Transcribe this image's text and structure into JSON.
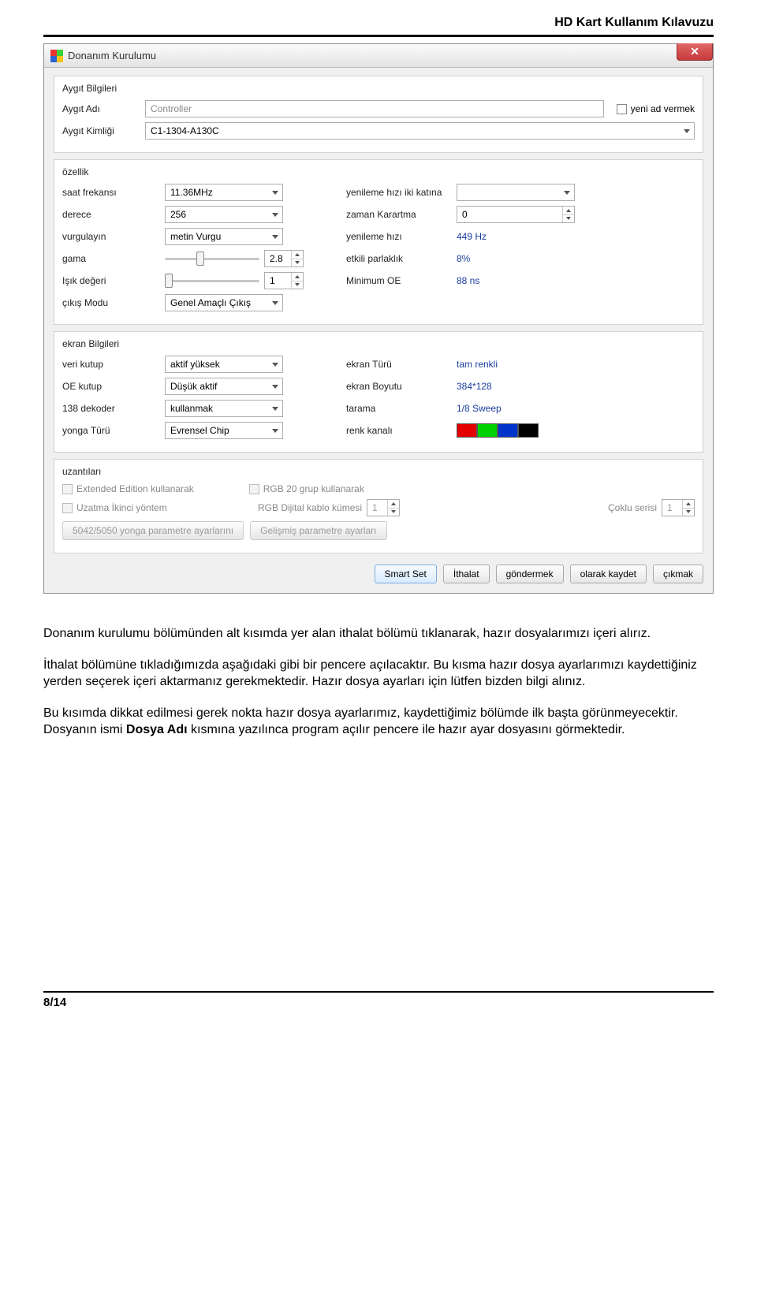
{
  "doc": {
    "header": "HD Kart Kullanım Kılavuzu",
    "page": "8/14"
  },
  "win": {
    "title": "Donanım Kurulumu"
  },
  "dev": {
    "section": "Aygıt Bilgileri",
    "name_lbl": "Aygıt Adı",
    "name_val": "Controller",
    "rename_lbl": "yeni ad vermek",
    "id_lbl": "Aygıt Kimliği",
    "id_val": "C1-1304-A130C"
  },
  "prop": {
    "section": "özellik",
    "clock_lbl": "saat frekansı",
    "clock_val": "11.36MHz",
    "refresh2_lbl": "yenileme hızı iki katına",
    "refresh2_val": "",
    "grade_lbl": "derece",
    "grade_val": "256",
    "blank_lbl": "zaman Karartma",
    "blank_val": "0",
    "emph_lbl": "vurgulayın",
    "emph_val": "metin Vurgu",
    "refresh_lbl": "yenileme hızı",
    "refresh_val": "449 Hz",
    "gamma_lbl": "gama",
    "gamma_val": "2.8",
    "eff_lbl": "etkili parlaklık",
    "eff_val": "8%",
    "light_lbl": "Işık değeri",
    "light_val": "1",
    "minoe_lbl": "Minimum OE",
    "minoe_val": "88 ns",
    "out_lbl": "çıkış Modu",
    "out_val": "Genel Amaçlı Çıkış"
  },
  "scr": {
    "section": "ekran Bilgileri",
    "dpol_lbl": "veri kutup",
    "dpol_val": "aktif yüksek",
    "type_lbl": "ekran Türü",
    "type_val": "tam renkli",
    "oepol_lbl": "OE kutup",
    "oepol_val": "Düşük aktif",
    "size_lbl": "ekran Boyutu",
    "size_val": "384*128",
    "dec_lbl": "138 dekoder",
    "dec_val": "kullanmak",
    "scan_lbl": "tarama",
    "scan_val": "1/8 Sweep",
    "chip_lbl": "yonga Türü",
    "chip_val": "Evrensel Chip",
    "chan_lbl": "renk kanalı",
    "colors": [
      "#e40000",
      "#00d200",
      "#0033cc",
      "#000000"
    ]
  },
  "ext": {
    "section": "uzantıları",
    "ee_lbl": "Extended Edition kullanarak",
    "rgb20_lbl": "RGB 20 grup kullanarak",
    "delay_lbl": "Uzatma İkinci yöntem",
    "cable_lbl": "RGB Dijital kablo kümesi",
    "cable_val": "1",
    "multi_lbl": "Çoklu serisi",
    "multi_val": "1",
    "btn1": "5042/5050 yonga parametre ayarlarını",
    "btn2": "Gelişmiş parametre ayarları"
  },
  "btns": {
    "smart": "Smart Set",
    "import": "İthalat",
    "send": "göndermek",
    "save": "olarak kaydet",
    "exit": "çıkmak"
  },
  "prose": {
    "p1": "Donanım kurulumu bölümünden alt kısımda yer alan ithalat bölümü tıklanarak, hazır dosyalarımızı içeri alırız.",
    "p2": "İthalat bölümüne tıkladığımızda aşağıdaki gibi bir pencere açılacaktır. Bu kısma hazır dosya ayarlarımızı kaydettiğiniz yerden seçerek içeri aktarmanız gerekmektedir. Hazır dosya ayarları için lütfen bizden bilgi alınız.",
    "p3a": "Bu kısımda dikkat edilmesi gerek nokta hazır dosya ayarlarımız, kaydettiğimiz bölümde ilk başta görünmeyecektir. Dosyanın ismi ",
    "p3b": "Dosya Adı",
    "p3c": " kısmına yazılınca program açılır pencere ile hazır ayar dosyasını görmektedir."
  }
}
